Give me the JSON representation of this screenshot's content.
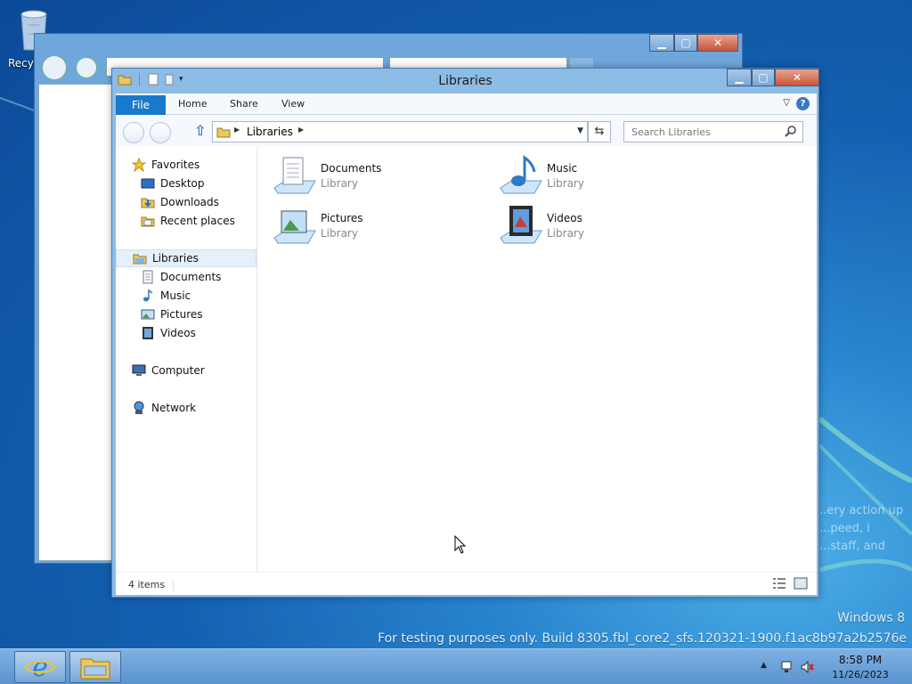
{
  "desktop": {
    "recycle_label": "Recyc",
    "watermark_os": "Windows 8",
    "watermark_build": "For testing purposes only. Build 8305.fbl_core2_sfs.120321-1900.f1ac8b97a2b2576e",
    "bg_lines": [
      "..ery action up",
      "...peed, i",
      "...staff, and"
    ]
  },
  "window": {
    "title": "Libraries",
    "ribbon": {
      "file": "File",
      "tabs": [
        "Home",
        "Share",
        "View"
      ]
    },
    "address": {
      "root": "Libraries"
    },
    "search": {
      "placeholder": "Search Libraries"
    },
    "nav": {
      "favorites": "Favorites",
      "desktop": "Desktop",
      "downloads": "Downloads",
      "recent": "Recent places",
      "libraries": "Libraries",
      "documents": "Documents",
      "music": "Music",
      "pictures": "Pictures",
      "videos": "Videos",
      "computer": "Computer",
      "network": "Network"
    },
    "items": [
      {
        "name": "Documents",
        "type": "Library"
      },
      {
        "name": "Music",
        "type": "Library"
      },
      {
        "name": "Pictures",
        "type": "Library"
      },
      {
        "name": "Videos",
        "type": "Library"
      }
    ],
    "status": {
      "count": "4 items"
    }
  },
  "taskbar": {
    "time": "8:58 PM",
    "date": "11/26/2023"
  },
  "colors": {
    "accent": "#1979ca",
    "selection": "#e5f0fb"
  }
}
